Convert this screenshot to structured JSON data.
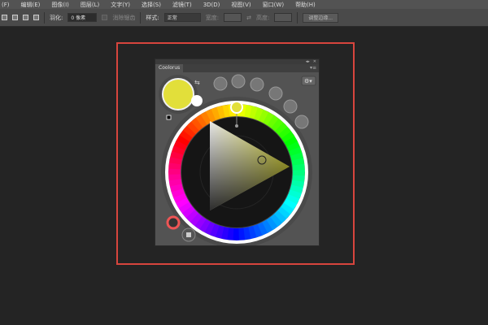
{
  "menu": [
    "(F)",
    "编辑(E)",
    "图像(I)",
    "图层(L)",
    "文字(Y)",
    "选择(S)",
    "滤镜(T)",
    "3D(D)",
    "视图(V)",
    "窗口(W)",
    "帮助(H)"
  ],
  "options": {
    "feather_label": "羽化:",
    "feather_value": "0 像素",
    "antialias_label": "消除锯齿",
    "style_label": "样式:",
    "style_value": "正常",
    "width_label": "宽度:",
    "height_label": "高度:",
    "refine_edge": "调整边缘..."
  },
  "panel": {
    "title": "Coolorus",
    "header_icons": [
      "collapse-icon",
      "close-icon"
    ],
    "current_color": "#e2df3a",
    "secondary_color": "#ffffff"
  }
}
